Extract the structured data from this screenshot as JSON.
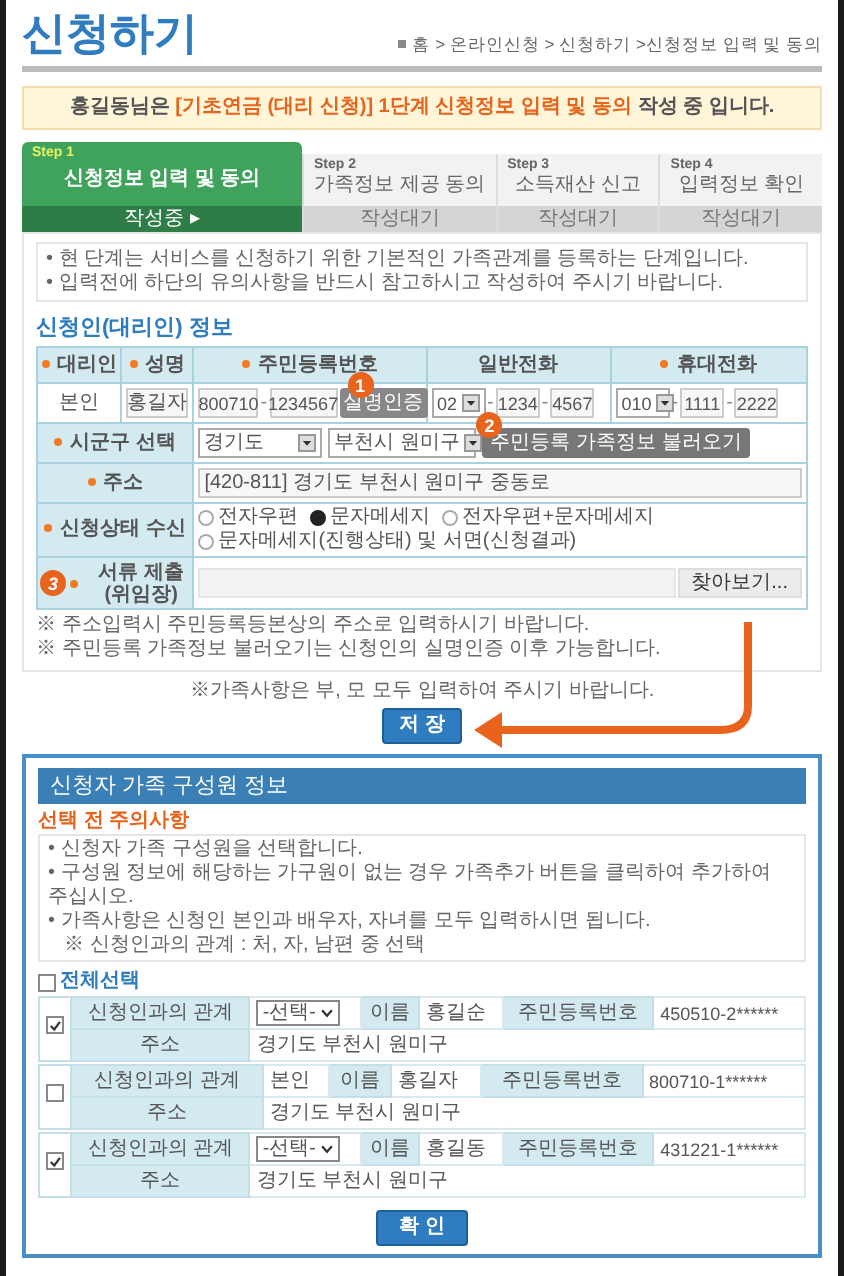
{
  "page_title": "신청하기",
  "breadcrumb": "홈 > 온라인신청 > 신청하기 >신청정보 입력 및 동의",
  "notice": {
    "before": "홍길동님은 ",
    "highlight": "[기초연금 (대리 신청)]  1단계 신청정보 입력 및 동의",
    "after": " 작성 중 입니다."
  },
  "steps": [
    {
      "step": "Step 1",
      "title": "신청정보 입력 및 동의",
      "status": "작성중 ▸",
      "selected": true
    },
    {
      "step": "Step 2",
      "title": "가족정보 제공 동의",
      "status": "작성대기",
      "selected": false
    },
    {
      "step": "Step 3",
      "title": "소득재산 신고",
      "status": "작성대기",
      "selected": false
    },
    {
      "step": "Step 4",
      "title": "입력정보 확인",
      "status": "작성대기",
      "selected": false
    }
  ],
  "intro_bullets": [
    "• 현 단계는 서비스를 신청하기 위한 기본적인 가족관계를 등록하는 단계입니다.",
    "• 입력전에 하단의 유의사항을 반드시 참고하시고 작성하여 주시기 바랍니다."
  ],
  "applicant": {
    "title": "신청인(대리인) 정보",
    "columns": [
      {
        "label": "대리인",
        "required": true
      },
      {
        "label": "성명",
        "required": true
      },
      {
        "label": "주민등록번호",
        "required": true
      },
      {
        "label": "일반전화",
        "required": false
      },
      {
        "label": "휴대전화",
        "required": true
      }
    ],
    "row": {
      "separator": "-",
      "relation": "본인",
      "name": "홍길자",
      "rrn_front": "800710",
      "rrn_back": "1234567",
      "verify_button": "실명인증",
      "verify_callout": "1",
      "phone": [
        "02",
        "1234",
        "4567"
      ],
      "mobile": [
        "010",
        "1111",
        "2222"
      ]
    },
    "region": {
      "label": "시군구 선택",
      "required": true,
      "province": "경기도",
      "city": "부천시 원미구",
      "load_button": "주민등록 가족정보 불러오기",
      "callout": "2"
    },
    "address": {
      "label": "주소",
      "required": true,
      "value": "[420-811] 경기도 부천시 원미구 중동로"
    },
    "notify": {
      "label": "신청상태 수신",
      "required": true,
      "options": [
        {
          "label": "전자우편",
          "selected": false
        },
        {
          "label": "문자메세지",
          "selected": true
        },
        {
          "label": "전자우편+문자메세지",
          "selected": false
        },
        {
          "label": "문자메세지(진행상태) 및 서면(신청결과)",
          "selected": false
        }
      ]
    },
    "documents": {
      "label": "서류 제출",
      "sublabel": "(위임장)",
      "required": true,
      "callout": "3",
      "browse_button": "찾아보기..."
    },
    "notes": [
      "※ 주소입력시 주민등록등본상의 주소로 입력하시기 바랍니다.",
      "※ 주민등록 가족정보 불러오기는 신청인의 실명인증 이후 가능합니다."
    ]
  },
  "reminder": "※가족사항은 부, 모 모두 입력하여 주시기 바랍니다.",
  "save_button": "저 장",
  "family": {
    "title": "신청자 가족 구성원 정보",
    "caution_title": "선택 전 주의사항",
    "caution": [
      "• 신청자 가족 구성원을 선택합니다.",
      "• 구성원 정보에 해당하는 가구원이 없는 경우 가족추가 버튼을 클릭하여 추가하여 주십시오.",
      "• 가족사항은 신청인 본인과 배우자, 자녀를 모두 입력하시면 됩니다."
    ],
    "caution_note": "※ 신청인과의 관계 : 처, 자, 남편 중 선택",
    "select_all": {
      "label": "전체선택",
      "checked": false
    },
    "members": [
      {
        "checked": true,
        "relation_label": "신청인과의 관계",
        "relation": {
          "kind": "select",
          "value": "-선택-"
        },
        "name_label": "이름",
        "name": "홍길순",
        "rrn_label": "주민등록번호",
        "rrn": "450510-2******",
        "address_label": "주소",
        "address": "경기도 부천시 원미구"
      },
      {
        "checked": false,
        "relation_label": "신청인과의 관계",
        "relation": {
          "kind": "text",
          "value": "본인"
        },
        "name_label": "이름",
        "name": "홍길자",
        "rrn_label": "주민등록번호",
        "rrn": "800710-1******",
        "address_label": "주소",
        "address": "경기도 부천시 원미구"
      },
      {
        "checked": true,
        "relation_label": "신청인과의 관계",
        "relation": {
          "kind": "select",
          "value": "-선택-"
        },
        "name_label": "이름",
        "name": "홍길동",
        "rrn_label": "주민등록번호",
        "rrn": "431221-1******",
        "address_label": "주소",
        "address": "경기도 부천시 원미구"
      }
    ],
    "confirm_button": "확 인"
  }
}
